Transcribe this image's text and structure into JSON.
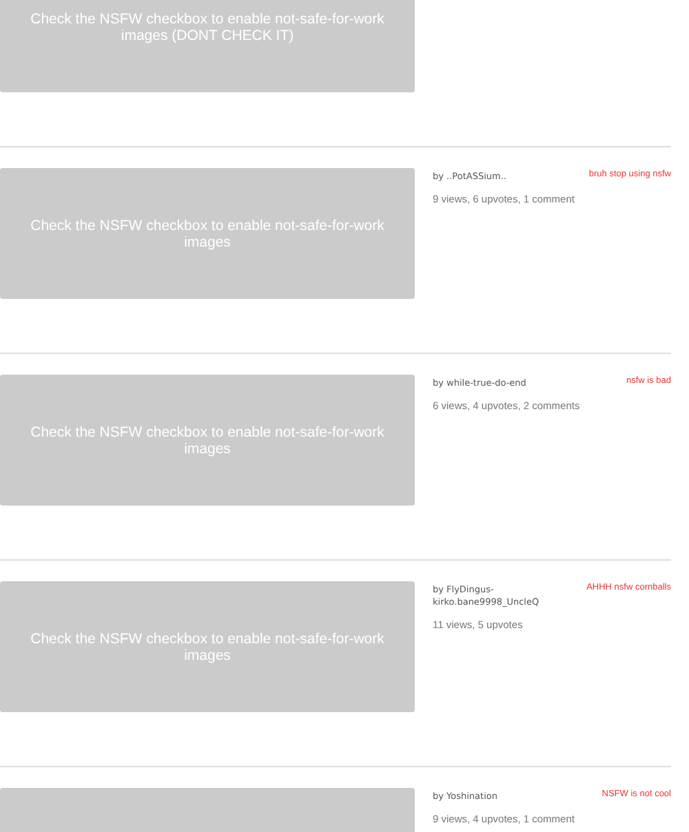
{
  "posts": [
    {
      "image_text": "Check the NSFW checkbox to enable not-safe-for-work images (DONT CHECK IT)"
    },
    {
      "image_text": "Check the NSFW checkbox to enable not-safe-for-work images",
      "author": "by ..PotASSium..",
      "stats": "9 views, 6 upvotes, 1 comment",
      "comment": "bruh stop using nsfw"
    },
    {
      "image_text": "Check the NSFW checkbox to enable not-safe-for-work images",
      "author": "by while-true-do-end",
      "stats": "6 views, 4 upvotes, 2 comments",
      "comment": "nsfw is bad"
    },
    {
      "image_text": "Check the NSFW checkbox to enable not-safe-for-work images",
      "author": "by FlyDingus-kirko.bane9998_UncleQ",
      "stats": "11 views, 5 upvotes",
      "comment": "AHHH nsfw cornballs"
    },
    {
      "author": "by Yoshination",
      "stats": "9 views, 4 upvotes, 1 comment",
      "comment": "NSFW is not cool"
    }
  ]
}
